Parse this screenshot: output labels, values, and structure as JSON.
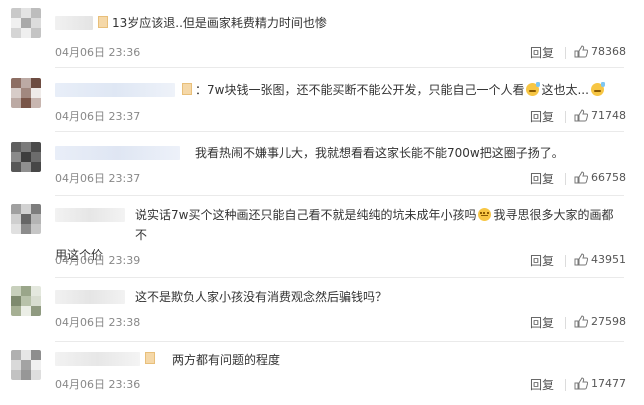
{
  "comments": [
    {
      "text_parts": [
        "13岁应该退..但是画家耗费精力时间也惨"
      ],
      "time": "04月06日 23:36",
      "reply_label": "回复",
      "likes": "78368"
    },
    {
      "text_parts": [
        "：7w块钱一张图，还不能买断不能公开发，只能自己一个人看",
        "这也太..."
      ],
      "time": "04月06日 23:37",
      "reply_label": "回复",
      "likes": "71748"
    },
    {
      "text_parts": [
        "我看热闹不嫌事儿大，我就想看看这家长能不能700w把这圈子扬了。"
      ],
      "time": "04月06日 23:37",
      "reply_label": "回复",
      "likes": "66758"
    },
    {
      "text_parts": [
        "说实话7w买个这种画还只能自己看不就是纯纯的坑未成年小孩吗",
        "我寻思很多大家的画都不",
        "用这个价"
      ],
      "time": "04月06日 23:39",
      "reply_label": "回复",
      "likes": "43951"
    },
    {
      "text_parts": [
        "这不是欺负人家小孩没有消费观念然后骗钱吗？"
      ],
      "time": "04月06日 23:38",
      "reply_label": "回复",
      "likes": "27598"
    },
    {
      "text_parts": [
        "两方都有问题的程度"
      ],
      "time": "04月06日 23:36",
      "reply_label": "回复",
      "likes": "17477"
    }
  ],
  "icons": {
    "like": "thumbs-up-icon",
    "emoji_sweat": "sweat-emoji-icon",
    "emoji_speechless": "speechless-emoji-icon"
  },
  "colors": {
    "text": "#333333",
    "meta": "#888888",
    "divider": "#eaeaea"
  }
}
